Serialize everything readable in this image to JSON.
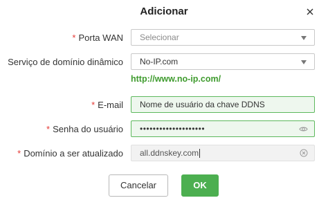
{
  "dialog": {
    "title": "Adicionar"
  },
  "form": {
    "wan_port": {
      "label": "Porta WAN",
      "placeholder": "Selecionar"
    },
    "ddns_service": {
      "label": "Serviço de domínio dinâmico",
      "value": "No-IP.com"
    },
    "service_link": "http://www.no-ip.com/",
    "email": {
      "label": "E-mail",
      "value": "Nome de usuário da chave DDNS"
    },
    "password": {
      "label": "Senha do usuário",
      "value": "••••••••••••••••••••"
    },
    "domain": {
      "label": "Domínio a ser atualizado",
      "value": "all.ddnskey.com"
    },
    "required_marker": "*"
  },
  "buttons": {
    "cancel": "Cancelar",
    "ok": "OK"
  },
  "colors": {
    "accent_green": "#4caf50",
    "link_green": "#3f9b2e",
    "required_red": "#e53935"
  },
  "icons": {
    "close": "close-icon",
    "dropdown": "chevron-down-icon",
    "password_toggle": "eye-icon",
    "clear": "clear-circle-icon"
  }
}
